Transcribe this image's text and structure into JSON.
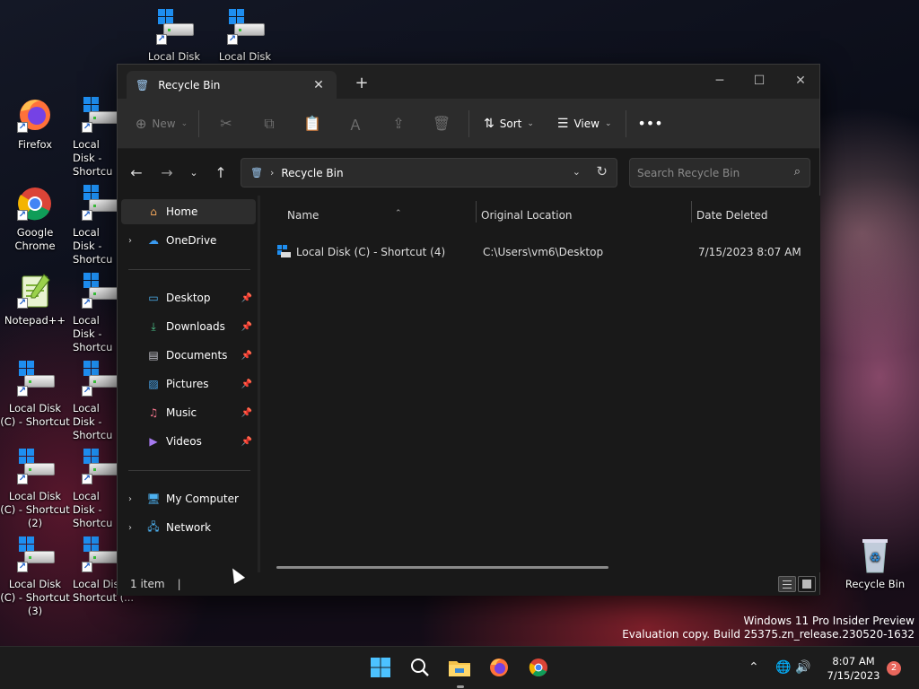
{
  "desktop": {
    "icons": [
      {
        "label": "Local Disk (C)",
        "type": "drive"
      },
      {
        "label": "Local Disk (C)",
        "type": "drive"
      },
      {
        "label": "Firefox",
        "type": "firefox"
      },
      {
        "label": "Local Disk - Shortcu",
        "type": "drive"
      },
      {
        "label": "Google Chrome",
        "type": "chrome"
      },
      {
        "label": "Local Disk - Shortcu",
        "type": "drive"
      },
      {
        "label": "Notepad++",
        "type": "notepad"
      },
      {
        "label": "Local Disk - Shortcu",
        "type": "drive"
      },
      {
        "label": "Local Disk (C) - Shortcut",
        "type": "drive"
      },
      {
        "label": "Local Disk - Shortcu",
        "type": "drive"
      },
      {
        "label": "Local Disk (C) - Shortcut (2)",
        "type": "drive"
      },
      {
        "label": "Local Disk - Shortcu",
        "type": "drive"
      },
      {
        "label": "Local Disk (C) - Shortcut (3)",
        "type": "drive"
      },
      {
        "label": "Local Disk - Shortcut (...",
        "type": "drive"
      }
    ],
    "recycle_bin_label": "Recycle Bin"
  },
  "window": {
    "tab_title": "Recycle Bin",
    "tab_icon": "recycle-bin-icon",
    "controls": [
      "minimize",
      "maximize",
      "close"
    ]
  },
  "toolbar": {
    "new_label": "New",
    "sort_label": "Sort",
    "view_label": "View",
    "disabled_icons": [
      "cut-icon",
      "copy-icon",
      "paste-icon",
      "rename-icon",
      "share-icon",
      "delete-icon"
    ]
  },
  "address": {
    "path": "Recycle Bin",
    "search_placeholder": "Search Recycle Bin"
  },
  "nav": {
    "home": "Home",
    "onedrive": "OneDrive",
    "quick_access": [
      "Desktop",
      "Downloads",
      "Documents",
      "Pictures",
      "Music",
      "Videos"
    ],
    "my_computer": "My Computer",
    "network": "Network"
  },
  "content": {
    "columns": [
      "Name",
      "Original Location",
      "Date Deleted"
    ],
    "rows": [
      {
        "name": "Local Disk (C) - Shortcut (4)",
        "location": "C:\\Users\\vm6\\Desktop",
        "date": "7/15/2023 8:07 AM"
      }
    ]
  },
  "status": {
    "item_count": "1 item"
  },
  "watermark": {
    "line1": "Windows 11 Pro Insider Preview",
    "line2": "Evaluation copy. Build 25375.zn_release.230520-1632"
  },
  "taskbar": {
    "time": "8:07 AM",
    "date": "7/15/2023",
    "notifications": "2"
  },
  "colors": {
    "window_bg": "#191919",
    "toolbar_bg": "#2c2c2c",
    "accent": "#1e8ef0"
  }
}
